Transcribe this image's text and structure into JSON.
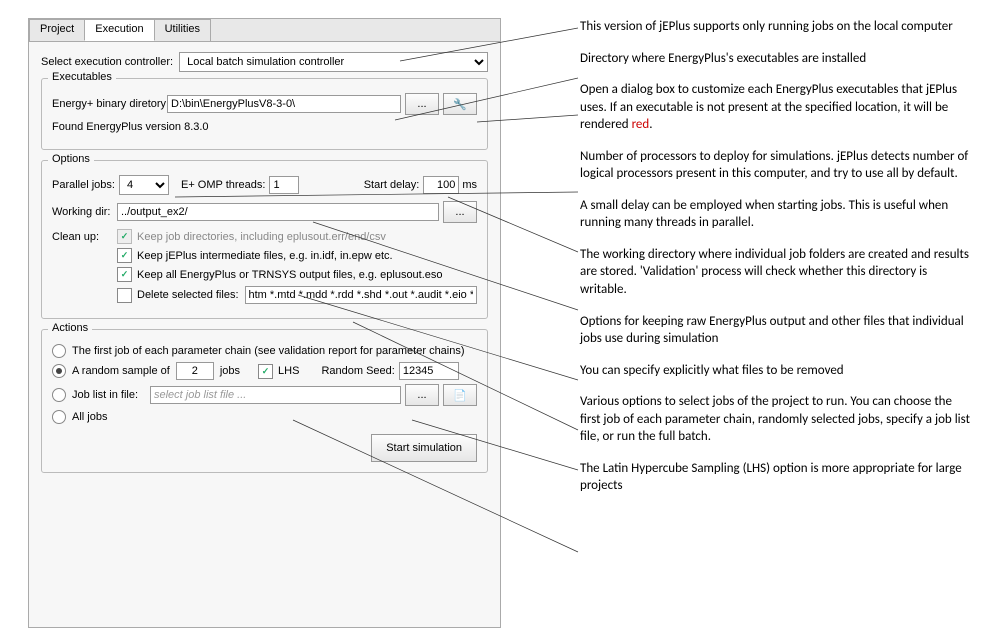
{
  "tabs": {
    "project": "Project",
    "execution": "Execution",
    "utilities": "Utilities"
  },
  "controller": {
    "label": "Select execution controller:",
    "value": "Local batch simulation controller"
  },
  "executables": {
    "legend": "Executables",
    "binaryLabel": "Energy+ binary diretory",
    "binaryPath": "D:\\bin\\EnergyPlusV8-3-0\\",
    "foundText": "Found EnergyPlus version 8.3.0"
  },
  "options": {
    "legend": "Options",
    "parallelLabel": "Parallel jobs:",
    "parallelValue": "4",
    "ompLabel": "E+ OMP threads:",
    "ompValue": "1",
    "startDelayLabel": "Start delay:",
    "startDelayValue": "100",
    "startDelayUnit": "ms",
    "workingDirLabel": "Working dir:",
    "workingDirValue": "../output_ex2/",
    "cleanupLabel": "Clean up:",
    "cb1": "Keep job directories, including eplusout.err/end/csv",
    "cb2": "Keep jEPlus intermediate files, e.g. in.idf, in.epw etc.",
    "cb3": "Keep all EnergyPlus or TRNSYS output files, e.g. eplusout.eso",
    "cb4": "Delete selected files:",
    "deleteFiles": "htm *.mtd *.mdd *.rdd *.shd *.out *.audit *.eio *.idd"
  },
  "actions": {
    "legend": "Actions",
    "r1": "The first job of each parameter chain (see validation report for parameter chains)",
    "r2a": "A random sample of",
    "r2val": "2",
    "r2b": "jobs",
    "lhs": "LHS",
    "seedLabel": "Random Seed:",
    "seedValue": "12345",
    "r3": "Job list in file:",
    "r3placeholder": "select job list file ...",
    "r4": "All jobs",
    "startBtn": "Start simulation"
  },
  "annos": {
    "a1": "This version of jEPlus supports only running jobs on the local computer",
    "a2": "Directory where EnergyPlus's executables are installed",
    "a3a": "Open a dialog box to customize each EnergyPlus executables that jEPlus uses. If an executable is not present at the specified location, it will be rendered ",
    "a3b": "red",
    "a3c": ".",
    "a4": "Number of processors to deploy for simulations. jEPlus detects number of logical processors present in this computer, and try to use all by default.",
    "a5": "A small delay can be employed when starting jobs. This is useful when running many threads in parallel.",
    "a6": "The working directory where individual job folders are created and results are stored. 'Validation' process will check whether this directory is writable.",
    "a7": "Options for keeping raw EnergyPlus output and other files that individual jobs use during simulation",
    "a8": "You can specify explicitly what files to be removed",
    "a9": "Various options to select jobs of the project to run. You can choose the first job of each parameter chain, randomly selected jobs, specify a job list file, or run the full batch.",
    "a10": "The Latin Hypercube Sampling (LHS) option is more appropriate for large projects"
  }
}
